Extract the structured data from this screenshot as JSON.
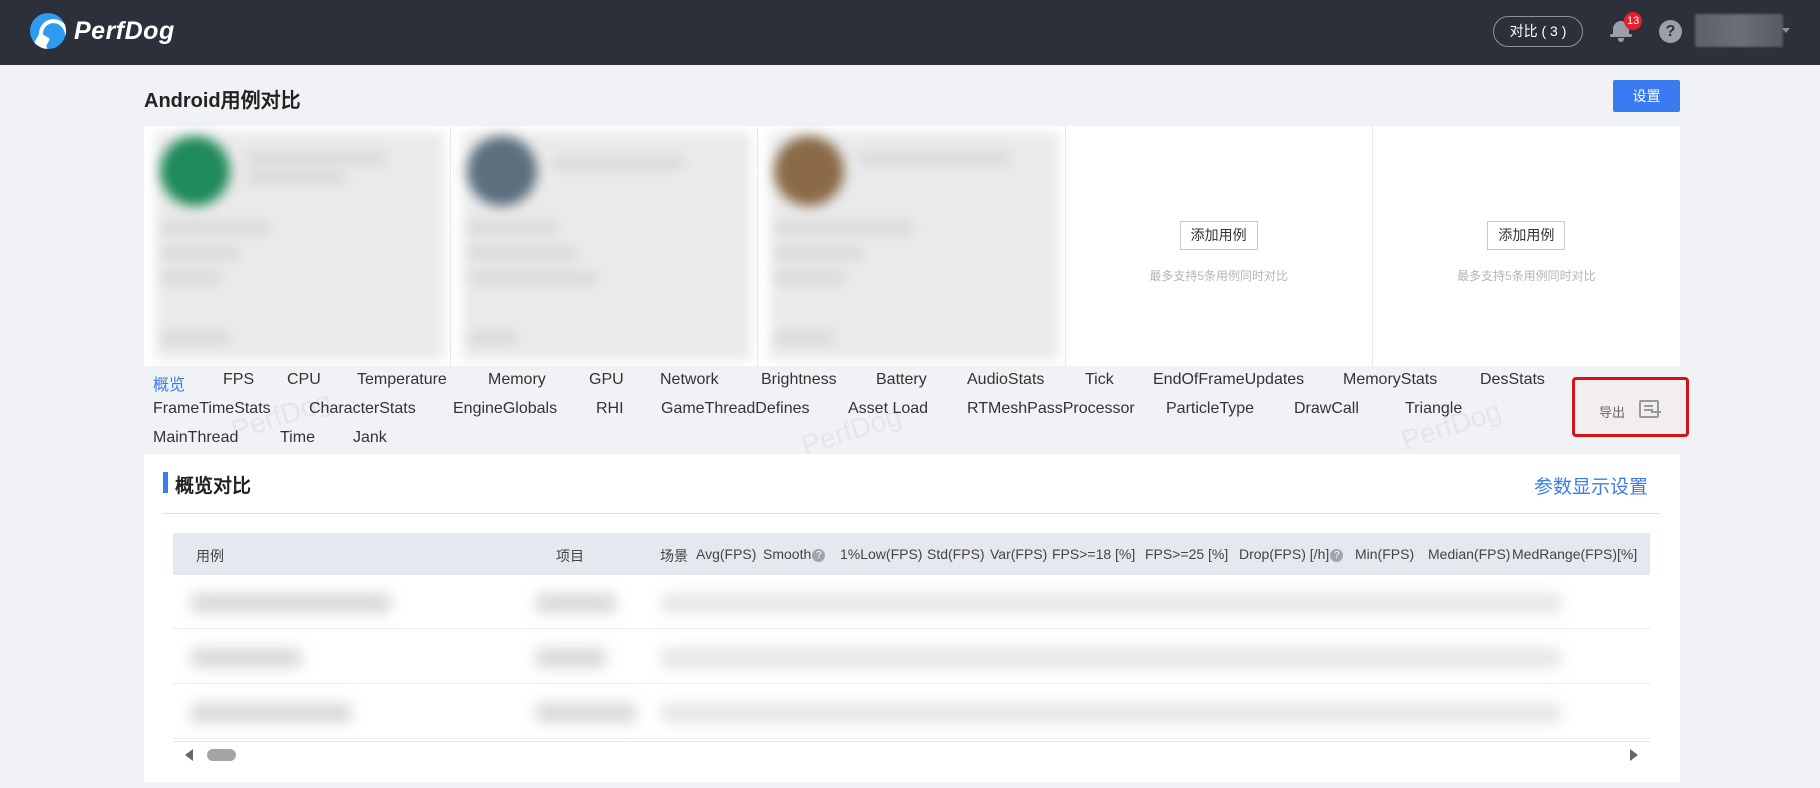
{
  "app": {
    "logo_text": "PerfDog",
    "logo_icon": "perfdog-logo-icon"
  },
  "header": {
    "compare_label": "对比 ( 3 )",
    "notification_count": "13",
    "help_label": "?"
  },
  "page": {
    "title": "Android用例对比",
    "settings_label": "设置"
  },
  "cases": {
    "add_label": "添加用例",
    "add_hint": "最多支持5条用例同时对比",
    "blurred_card_colors": [
      "#1f8a5a",
      "#5b6f7e",
      "#8a6a48"
    ]
  },
  "tabs": [
    "概览",
    "FPS",
    "CPU",
    "Temperature",
    "Memory",
    "GPU",
    "Network",
    "Brightness",
    "Battery",
    "AudioStats",
    "Tick",
    "EndOfFrameUpdates",
    "MemoryStats",
    "DesStats",
    "FrameTimeStats",
    "CharacterStats",
    "EngineGlobals",
    "RHI",
    "GameThreadDefines",
    "Asset Load",
    "RTMeshPassProcessor",
    "ParticleType",
    "DrawCall",
    "Triangle",
    "MainThread",
    "Time",
    "Jank"
  ],
  "active_tab": "概览",
  "watermark": "PerfDog",
  "export": {
    "label": "导出",
    "icon": "export-icon"
  },
  "overview": {
    "title": "概览对比",
    "param_settings": "参数显示设置",
    "columns": [
      "用例",
      "项目",
      "场景",
      "Avg(FPS)",
      "Smooth",
      "1%Low(FPS)",
      "Std(FPS)",
      "Var(FPS)",
      "FPS>=18 [%]",
      "FPS>=25 [%]",
      "Drop(FPS) [/h]",
      "Min(FPS)",
      "Median(FPS)",
      "MedRange(FPS)[%]"
    ],
    "help_mark": "?"
  },
  "colors": {
    "accent": "#3b7bf1",
    "header_bg": "#2b303b",
    "highlight_border": "#d3121b",
    "badge": "#e4202d"
  }
}
